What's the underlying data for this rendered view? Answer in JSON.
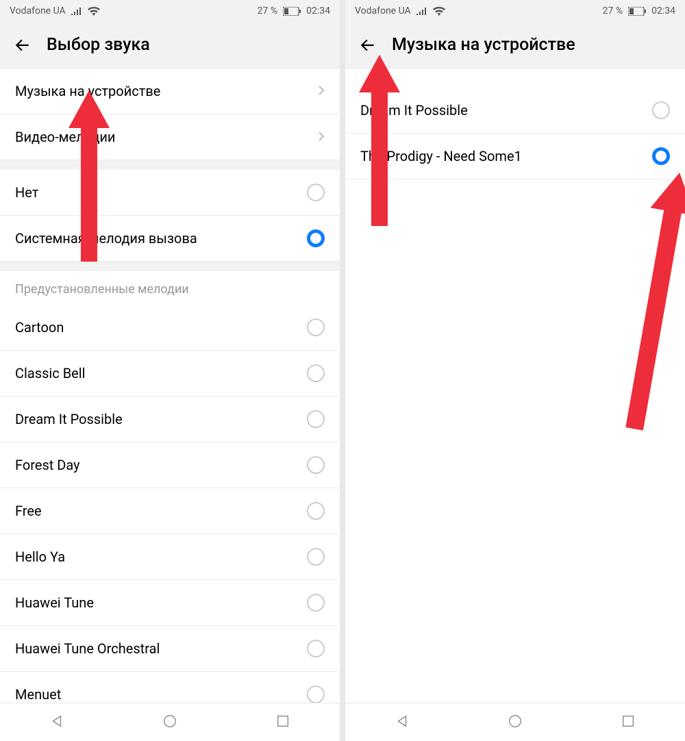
{
  "status": {
    "carrier": "Vodafone UA",
    "battery_pct": "27 %",
    "time": "02:34"
  },
  "left": {
    "title": "Выбор звука",
    "nav_rows": [
      {
        "label": "Музыка на устройстве"
      },
      {
        "label": "Видео-мелодии"
      }
    ],
    "option_rows": [
      {
        "label": "Нет",
        "selected": false
      },
      {
        "label": "Системная мелодия вызова",
        "selected": true
      }
    ],
    "preset_header": "Предустановленные мелодии",
    "preset_rows": [
      {
        "label": "Cartoon"
      },
      {
        "label": "Classic Bell"
      },
      {
        "label": "Dream It Possible"
      },
      {
        "label": "Forest Day"
      },
      {
        "label": "Free"
      },
      {
        "label": "Hello Ya"
      },
      {
        "label": "Huawei Tune"
      },
      {
        "label": "Huawei Tune Orchestral"
      },
      {
        "label": "Menuet"
      }
    ]
  },
  "right": {
    "title": "Музыка на устройстве",
    "rows": [
      {
        "label": "Dream It Possible",
        "selected": false
      },
      {
        "label": "The Prodigy - Need Some1",
        "selected": true
      }
    ]
  }
}
